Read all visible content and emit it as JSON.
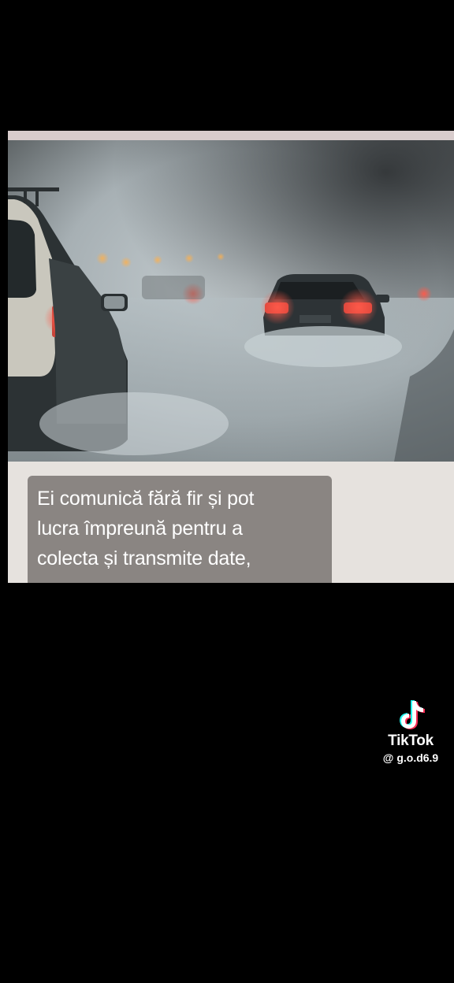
{
  "video": {
    "scene_description_icon": "foggy-highway-photo-icon",
    "caption_lines": [
      "Ei comunică fără fir și pot",
      "lucra împreună pentru a",
      "colecta și transmite date,"
    ]
  },
  "watermark": {
    "brand": "TikTok",
    "handle": "@ g.o.d6.9",
    "icon": "tiktok-logo-icon"
  },
  "colors": {
    "background": "#000000",
    "caption_box": "#8a8582",
    "caption_text": "#ffffff",
    "panel": "#e6e2de"
  }
}
